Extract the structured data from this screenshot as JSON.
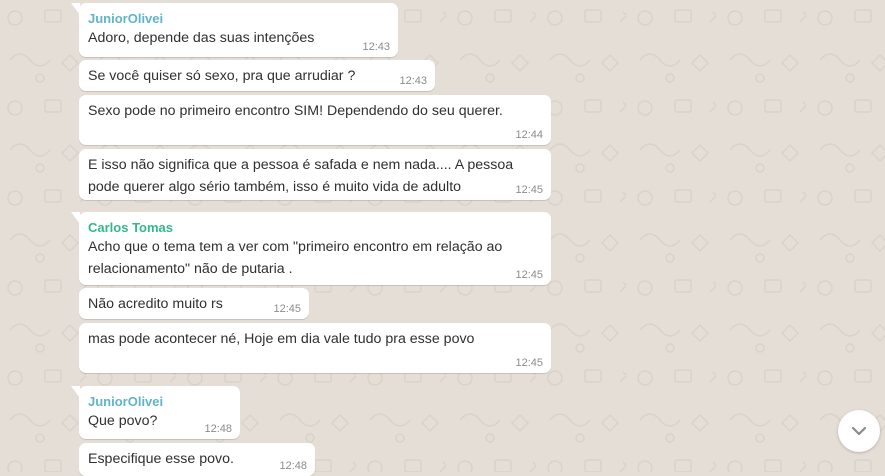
{
  "colors": {
    "chat_background": "#e5ded7",
    "bubble": "#ffffff",
    "text": "#303030",
    "time": "#8c8c8c"
  },
  "messages": [
    {
      "sender": "JuniorOlivei",
      "sender_color": "#5fb6c8",
      "text": "Adoro, depende das suas intenções",
      "time": "12:43"
    },
    {
      "sender": "",
      "text": "Se você quiser só sexo, pra que arrudiar ?",
      "time": "12:43"
    },
    {
      "sender": "",
      "text": "Sexo pode no primeiro encontro SIM! Dependendo do seu querer.",
      "time": "12:44"
    },
    {
      "sender": "",
      "text": "E isso não significa que a pessoa é safada e nem nada.... A pessoa pode querer algo sério também, isso é muito vida de adulto",
      "time": "12:45"
    },
    {
      "sender": "Carlos Tomas",
      "sender_color": "#35b889",
      "text": "Acho que o tema tem a ver com \"primeiro encontro em relação ao relacionamento\" não de putaria .",
      "time": "12:45"
    },
    {
      "sender": "",
      "text": "Não acredito muito rs",
      "time": "12:45"
    },
    {
      "sender": "",
      "text": "mas pode acontecer né, Hoje em dia vale tudo pra esse povo",
      "time": "12:45"
    },
    {
      "sender": "JuniorOlivei",
      "sender_color": "#5fb6c8",
      "text": "Que povo?",
      "time": "12:48"
    },
    {
      "sender": "",
      "text": "Especifique esse povo.",
      "time": "12:48"
    }
  ],
  "scroll_button": {
    "icon": "chevron-down-icon"
  }
}
